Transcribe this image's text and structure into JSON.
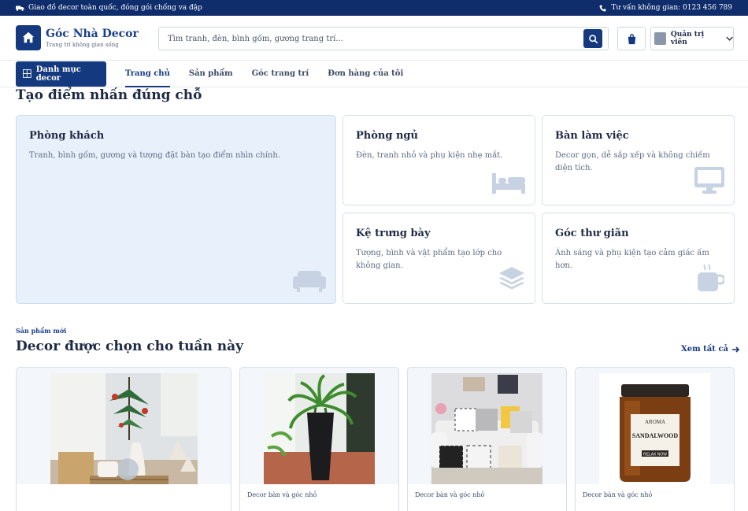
{
  "topbar": {
    "announcement": "Giao đồ decor toàn quốc, đóng gói chống va đập",
    "hotline": "Tư vấn không gian: 0123 456 789"
  },
  "header": {
    "brand_name": "Góc Nhà Decor",
    "brand_tagline": "Trang trí không gian sống",
    "search_placeholder": "Tìm tranh, đèn, bình gốm, gương trang trí...",
    "admin_label": "Quản trị viên"
  },
  "nav": {
    "category_button": "Danh mục decor",
    "tabs": [
      "Trang chủ",
      "Sản phẩm",
      "Góc trang trí",
      "Đơn hàng của tôi"
    ]
  },
  "spaces": {
    "title": "Tạo điểm nhấn đúng chỗ",
    "items": [
      {
        "name": "Phòng khách",
        "desc": "Tranh, bình gốm, gương và tượng đặt bàn tạo điểm nhìn chính.",
        "icon": "sofa-icon"
      },
      {
        "name": "Phòng ngủ",
        "desc": "Đèn, tranh nhỏ và phụ kiện nhẹ mắt.",
        "icon": "bed-icon"
      },
      {
        "name": "Bàn làm việc",
        "desc": "Decor gọn, dễ sắp xếp và không chiếm diện tích.",
        "icon": "desktop-icon"
      },
      {
        "name": "Kệ trưng bày",
        "desc": "Tượng, bình và vật phẩm tạo lớp cho không gian.",
        "icon": "layers-icon"
      },
      {
        "name": "Góc thư giãn",
        "desc": "Ánh sáng và phụ kiện tạo cảm giác ấm hơn.",
        "icon": "mug-icon"
      }
    ]
  },
  "products": {
    "kicker": "Sản phẩm mới",
    "title": "Decor được chọn cho tuần này",
    "see_all": "Xem tất cả",
    "items": [
      {
        "category": "",
        "image": "christmas-tree-decor"
      },
      {
        "category": "Decor bàn và góc nhỏ",
        "image": "potted-plant"
      },
      {
        "category": "Decor bàn và góc nhỏ",
        "image": "sofa-cushions"
      },
      {
        "category": "Decor bàn và góc nhỏ",
        "image": "sandalwood-candle",
        "label_text": "AROMA SANDALWOOD RELAX NOW"
      }
    ]
  },
  "colors": {
    "primary": "#14397f",
    "topbar": "#0f2c6b",
    "highlight_card": "#e8f0fb"
  }
}
